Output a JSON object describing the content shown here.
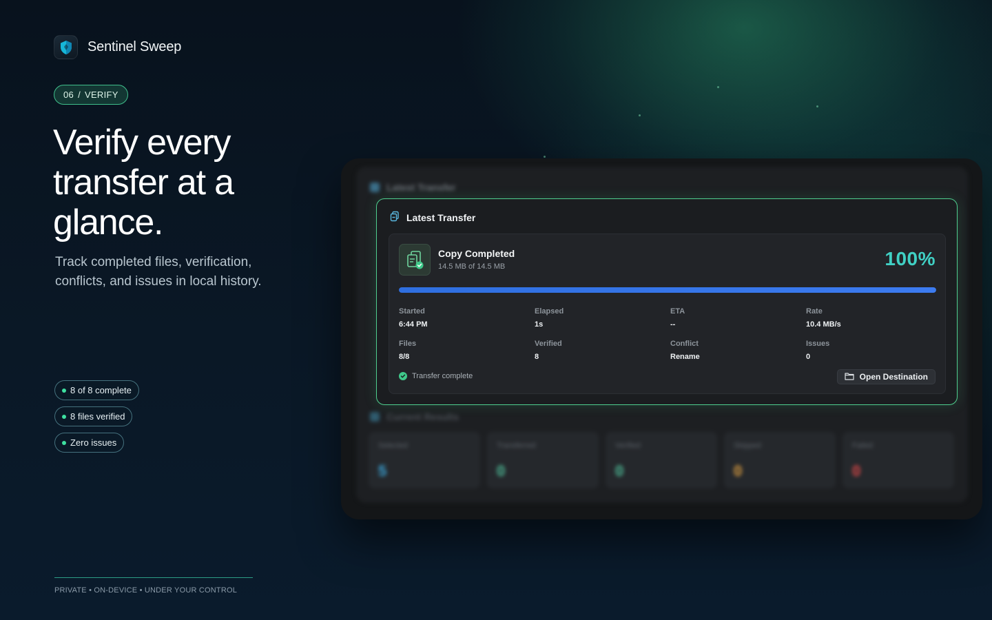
{
  "brand": {
    "name": "Sentinel Sweep",
    "icon": "shield-icon"
  },
  "step": {
    "number": "06",
    "separator": "/",
    "label": "VERIFY"
  },
  "headline": "Verify every transfer at a glance.",
  "subtitle": "Track completed files, verification, conflicts, and issues in local history.",
  "pills": [
    {
      "label": "8 of 8 complete"
    },
    {
      "label": "8 files verified"
    },
    {
      "label": "Zero issues"
    }
  ],
  "footer": "PRIVATE • ON-DEVICE • UNDER YOUR CONTROL",
  "app": {
    "bg_title": "Latest Transfer",
    "results_title": "Current Results",
    "results": [
      {
        "label": "Selected",
        "value": "5",
        "color": "#3aa4d8"
      },
      {
        "label": "Transferred",
        "value": "0",
        "color": "#4fbf9a"
      },
      {
        "label": "Verified",
        "value": "0",
        "color": "#4fbf9a"
      },
      {
        "label": "Skipped",
        "value": "0",
        "color": "#e0a040"
      },
      {
        "label": "Failed",
        "value": "0",
        "color": "#e04848"
      }
    ],
    "card": {
      "title": "Latest Transfer",
      "status_title": "Copy Completed",
      "size_text": "14.5 MB of 14.5 MB",
      "percent_text": "100%",
      "progress": 1.0,
      "stats": [
        {
          "label": "Started",
          "value": "6:44 PM"
        },
        {
          "label": "Elapsed",
          "value": "1s"
        },
        {
          "label": "ETA",
          "value": "--"
        },
        {
          "label": "Rate",
          "value": "10.4 MB/s"
        },
        {
          "label": "Files",
          "value": "8/8"
        },
        {
          "label": "Verified",
          "value": "8"
        },
        {
          "label": "Conflict",
          "value": "Rename"
        },
        {
          "label": "Issues",
          "value": "0"
        }
      ],
      "complete_text": "Transfer complete",
      "open_button": "Open Destination"
    }
  },
  "colors": {
    "accent_green": "#3fbf8c",
    "accent_teal": "#40d0c4",
    "progress_blue": "#2f6fe0",
    "background": "#0a1826"
  }
}
